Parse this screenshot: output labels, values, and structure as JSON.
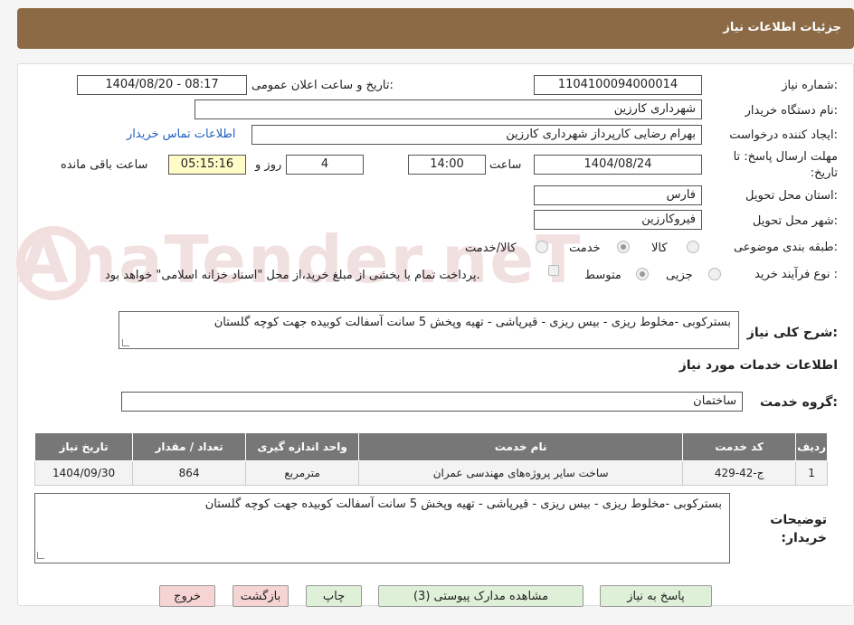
{
  "header": {
    "title": "جزئیات اطلاعات نیاز"
  },
  "watermark": "AnaTender.neT",
  "form": {
    "need_number_label": "شماره نیاز:",
    "need_number": "1104100094000014",
    "announce_label": "تاریخ و ساعت اعلان عمومی:",
    "announce_value": "1404/08/20 - 08:17",
    "buyer_org_label": "نام دستگاه خریدار:",
    "buyer_org": "شهرداری کارزین",
    "creator_label": "ایجاد کننده درخواست:",
    "creator": "بهرام رضایی کارپرداز شهرداری کارزین",
    "contact_link": "اطلاعات تماس خریدار",
    "deadline_label": "مهلت ارسال پاسخ: تا تاریخ:",
    "deadline_date": "1404/08/24",
    "time_label": "ساعت",
    "deadline_time": "14:00",
    "days_value": "4",
    "days_label": "روز و",
    "remaining_time": "05:15:16",
    "remaining_label": "ساعت باقی مانده",
    "province_label": "استان محل تحویل:",
    "province": "فارس",
    "city_label": "شهر محل تحویل:",
    "city": "فیروکارزین",
    "category_label": "طبقه بندی موضوعی:",
    "category_options": [
      "کالا",
      "خدمت",
      "کالا/خدمت"
    ],
    "category_selected": "خدمت",
    "process_label": "نوع فرآیند خرید :",
    "process_options": [
      "جزیی",
      "متوسط"
    ],
    "process_selected": "متوسط",
    "payment_note": "پرداخت تمام یا بخشی از مبلغ خرید،از محل \"اسناد خزانه اسلامی\" خواهد بود."
  },
  "summary": {
    "label": "شرح کلی نیاز:",
    "text": "بسترکوبی -مخلوط ریزی - بیس ریزی - قیرپاشی - تهیه وپخش 5 سانت آسفالت کوبیده جهت کوچه گلستان"
  },
  "services": {
    "section_title": "اطلاعات خدمات مورد نیاز",
    "group_label": "گروه خدمت:",
    "group_value": "ساختمان",
    "columns": [
      "ردیف",
      "کد خدمت",
      "نام خدمت",
      "واحد اندازه گیری",
      "تعداد / مقدار",
      "تاریخ نیاز"
    ],
    "rows": [
      {
        "row": "1",
        "code": "ج-42-429",
        "name": "ساخت سایر پروژه‌های مهندسی عمران",
        "unit": "مترمربع",
        "qty": "864",
        "date": "1404/09/30"
      }
    ]
  },
  "buyer_notes": {
    "label": "توضیحات خریدار:",
    "text": "بسترکوبی -مخلوط ریزی - بیس ریزی - قیرپاشی - تهیه وپخش 5 سانت آسفالت کوبیده جهت کوچه گلستان"
  },
  "buttons": {
    "respond": "پاسخ به نیاز",
    "attachments": "مشاهده مدارک پیوستی (3)",
    "print": "چاپ",
    "back": "بازگشت",
    "exit": "خروج"
  },
  "colors": {
    "header": "#8b6a45",
    "table_header": "#777777",
    "link": "#1f5fbf",
    "remaining_bg": "#fffcc8"
  }
}
